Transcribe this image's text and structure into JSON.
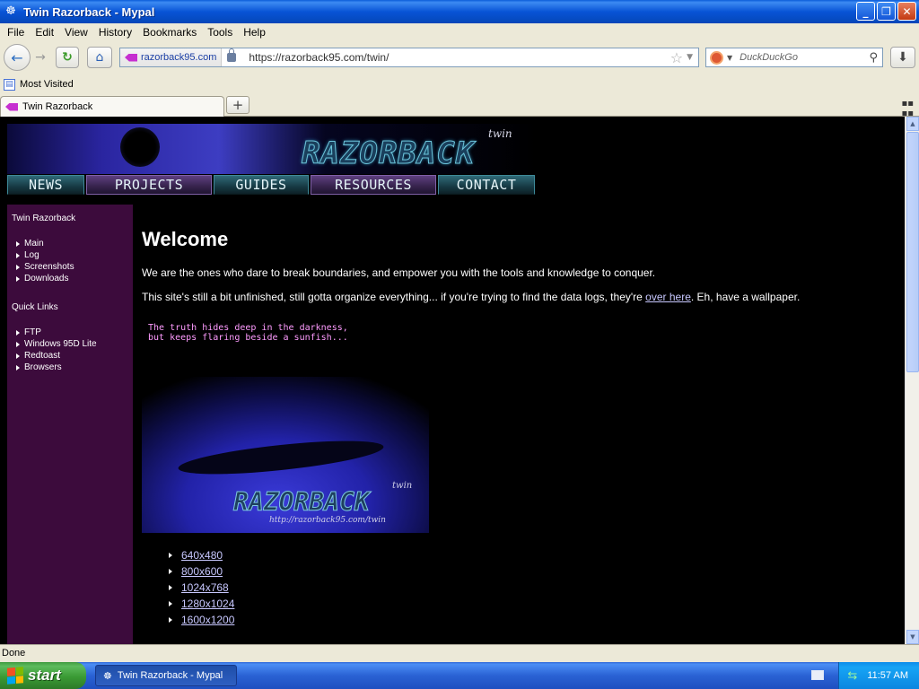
{
  "window": {
    "title": "Twin Razorback - Mypal"
  },
  "menu": [
    "File",
    "Edit",
    "View",
    "History",
    "Bookmarks",
    "Tools",
    "Help"
  ],
  "nav": {
    "identity": "razorback95.com",
    "url": "https://razorback95.com/twin/",
    "search_placeholder": "DuckDuckGo"
  },
  "bookmarks": {
    "most_visited": "Most Visited"
  },
  "tab": {
    "title": "Twin Razorback"
  },
  "site": {
    "banner_twin": "twin",
    "banner_logo": "RAZORBACK",
    "nav": [
      "NEWS",
      "PROJECTS",
      "GUIDES",
      "RESOURCES",
      "CONTACT"
    ],
    "sidebar": {
      "heading": "Twin Razorback",
      "items": [
        "Main",
        "Log",
        "Screenshots",
        "Downloads"
      ],
      "quick_heading": "Quick Links",
      "quick_items": [
        "FTP",
        "Windows 95D Lite",
        "Redtoast",
        "Browsers"
      ]
    },
    "heading": "Welcome",
    "intro": "We are the ones who dare to break boundaries, and empower you with the tools and knowledge to conquer.",
    "para_before": "This site's still a bit unfinished, still gotta organize everything... if you're trying to find the data logs, they're ",
    "para_link": "over here",
    "para_after": ". Eh, have a wallpaper.",
    "wallpaper": {
      "tagline": "The truth hides deep in the darkness,\nbut keeps flaring beside a sunfish...",
      "twin": "twin",
      "logo": "RAZORBACK",
      "url": "http://razorback95.com/twin"
    },
    "resolutions": [
      "640x480",
      "800x600",
      "1024x768",
      "1280x1024",
      "1600x1200"
    ]
  },
  "status": "Done",
  "taskbar": {
    "start": "start",
    "task": "Twin Razorback - Mypal",
    "time": "11:57 AM"
  }
}
